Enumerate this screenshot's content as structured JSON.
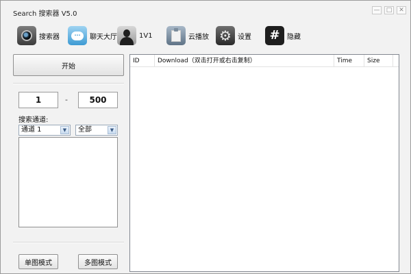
{
  "window": {
    "title": "Search 搜索器 V5.0",
    "controls": [
      "—",
      "□",
      "✕"
    ]
  },
  "toolbar": {
    "items": [
      {
        "label": "搜索器",
        "icon": "camera-icon"
      },
      {
        "label": "聊天大厅",
        "icon": "chat-bubble-icon"
      },
      {
        "label": "1V1",
        "icon": "user-silhouette-icon"
      },
      {
        "label": "云播放",
        "icon": "clipboard-icon"
      },
      {
        "label": "设置",
        "icon": "gear-icon"
      },
      {
        "label": "隐藏",
        "icon": "hash-icon"
      }
    ]
  },
  "left_panel": {
    "start_label": "开始",
    "range_from": "1",
    "range_sep": "-",
    "range_to": "500",
    "channel_label": "搜索通道:",
    "channel_select": "通道 1",
    "scope_select": "全部",
    "single_mode_label": "单图模式",
    "multi_mode_label": "多图模式"
  },
  "list": {
    "columns": [
      "ID",
      "Download（双击打开或右击复制）",
      "Time",
      "Size"
    ]
  }
}
